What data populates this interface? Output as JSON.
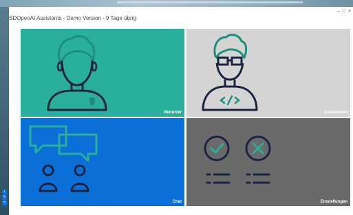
{
  "window": {
    "title": "SDOpenAI Assistants - Demo Version - 9 Tage übrig",
    "controls": {
      "minimize": "–",
      "maximize": "□",
      "close": "×"
    }
  },
  "tiles": {
    "benutzer": {
      "label": "Benutzer",
      "icon": "user-icon",
      "color": "#2aaf9d"
    },
    "assistenten": {
      "label": "Assistenten",
      "icon": "developer-icon",
      "color": "#d4d4d4"
    },
    "chat": {
      "label": "Chat",
      "icon": "chat-icon",
      "color": "#0a6fd6"
    },
    "einstellungen": {
      "label": "Einstellungen",
      "icon": "settings-checklist-icon",
      "color": "#6a6a6a"
    }
  },
  "side_icons": [
    {
      "name": "info-icon",
      "glyph": "i"
    },
    {
      "name": "search-icon",
      "glyph": "⚲"
    },
    {
      "name": "power-icon",
      "glyph": "⏻"
    }
  ]
}
